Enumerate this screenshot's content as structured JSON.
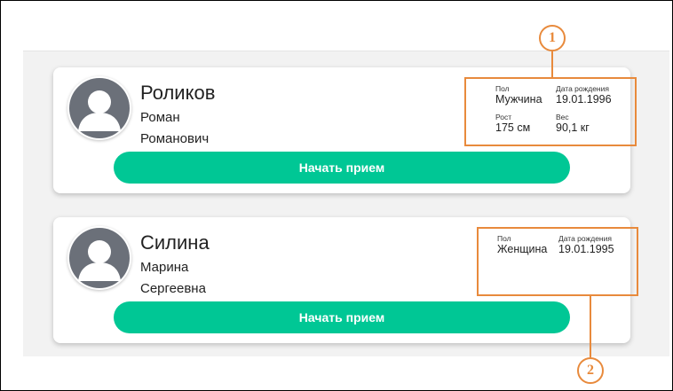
{
  "patients": [
    {
      "surname": "Роликов",
      "given_name": "Роман",
      "patronymic": "Романович",
      "sex_label": "Пол",
      "sex": "Мужчина",
      "birth_label": "Дата рождения",
      "birth_date": "19.01.1996",
      "height_label": "Рост",
      "height": "175 см",
      "weight_label": "Вес",
      "weight": "90,1 кг",
      "button_label": "Начать прием"
    },
    {
      "surname": "Силина",
      "given_name": "Марина",
      "patronymic": "Сергеевна",
      "sex_label": "Пол",
      "sex": "Женщина",
      "birth_label": "Дата рождения",
      "birth_date": "19.01.1995",
      "button_label": "Начать прием"
    }
  ],
  "annotations": [
    "1",
    "2"
  ],
  "colors": {
    "accent": "#00c795",
    "callout": "#e88a3c"
  }
}
